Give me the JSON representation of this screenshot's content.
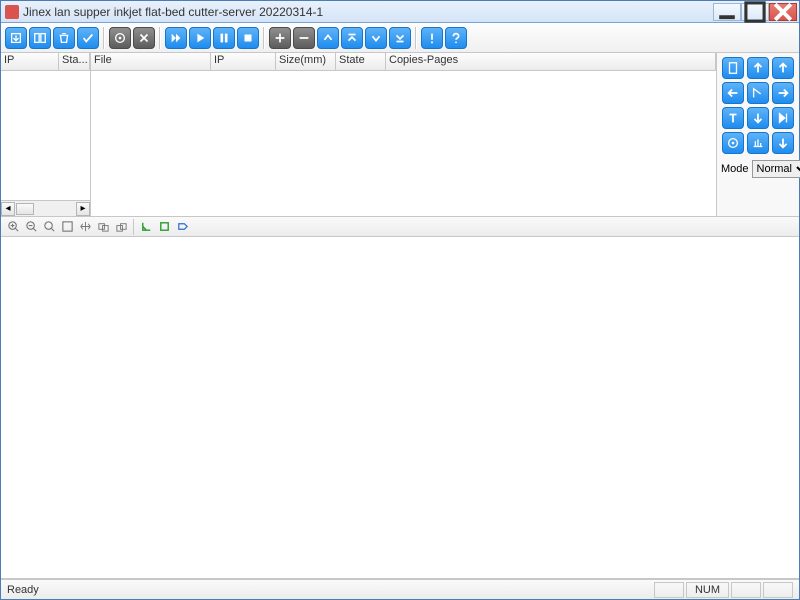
{
  "window": {
    "title": "Jinex lan supper inkjet flat-bed cutter-server 20220314-1"
  },
  "left_table": {
    "cols": [
      "IP",
      "Sta..."
    ]
  },
  "center_table": {
    "cols": [
      "File",
      "IP",
      "Size(mm)",
      "State",
      "Copies-Pages"
    ]
  },
  "mode": {
    "label": "Mode",
    "selected": "Normal",
    "options": [
      "Normal"
    ]
  },
  "statusbar": {
    "ready": "Ready",
    "num": "NUM"
  },
  "toolbar_icons": [
    "import",
    "layout",
    "delete",
    "confirm",
    "settings",
    "tools",
    "fast-forward",
    "play",
    "pause",
    "stop",
    "plus",
    "minus",
    "up",
    "top",
    "down",
    "bottom",
    "alert",
    "help"
  ],
  "nav_icons": [
    "page",
    "arrow-up",
    "arrow-up-double",
    "arrow-left",
    "origin",
    "arrow-right",
    "text-tool",
    "arrow-down",
    "skip",
    "target",
    "baseline",
    "arrow-down-double"
  ],
  "view_icons": [
    "zoom-in",
    "zoom-out",
    "zoom-area",
    "zoom-fit",
    "pan",
    "select-prev",
    "select-next",
    "measure",
    "snap",
    "toggle"
  ]
}
